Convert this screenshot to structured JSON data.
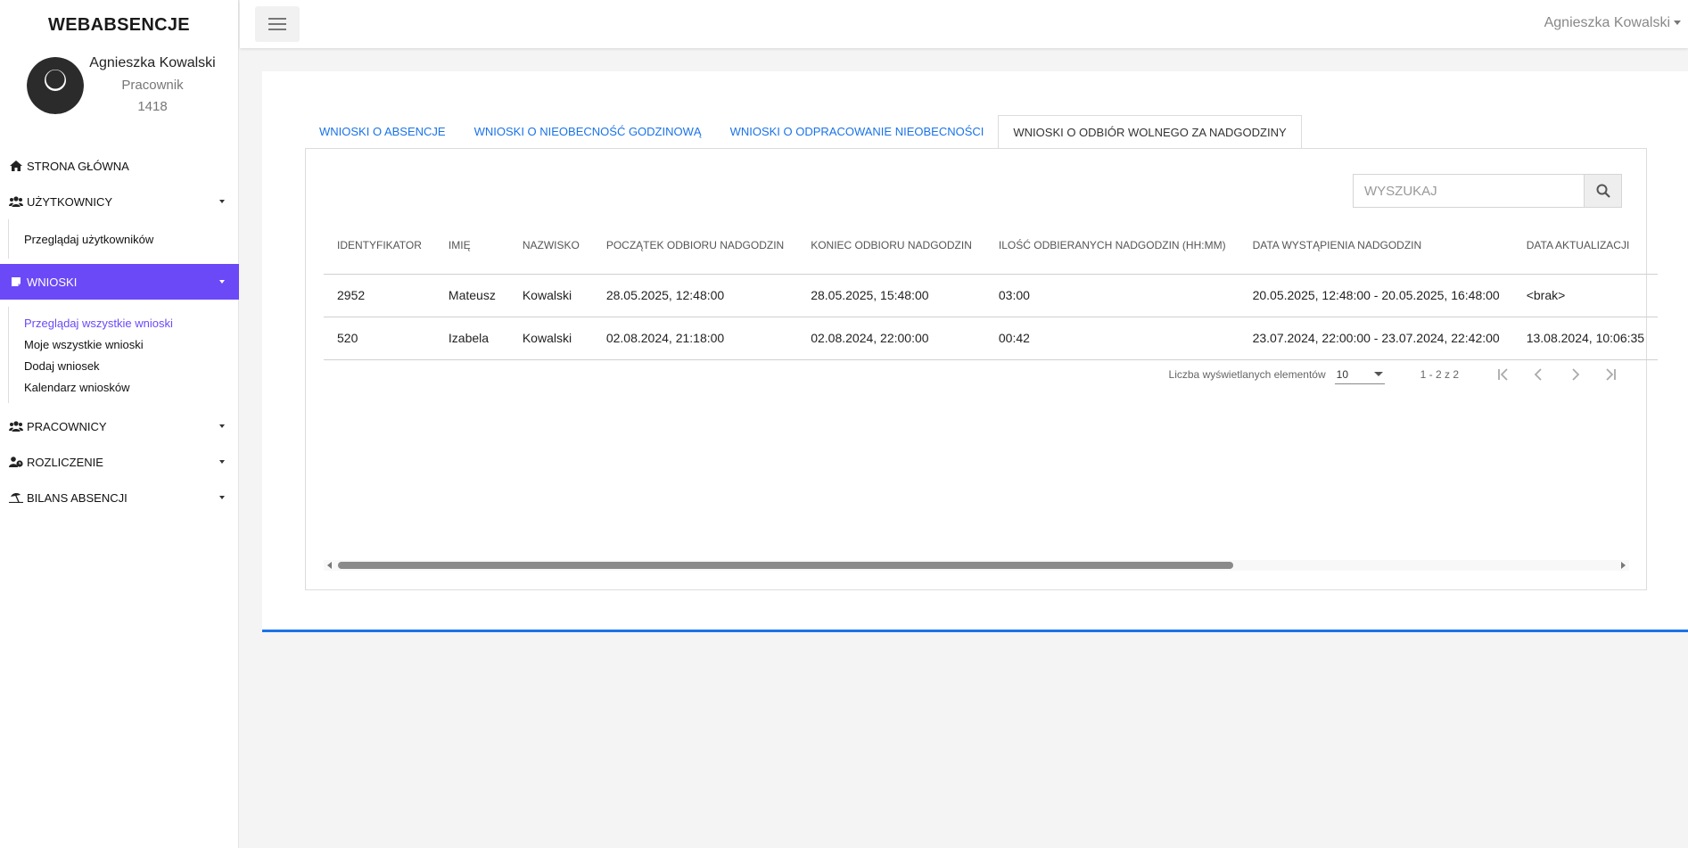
{
  "app": {
    "brand": "WEBABSENCJE"
  },
  "profile": {
    "name": "Agnieszka Kowalski",
    "role": "Pracownik",
    "id": "1418"
  },
  "sidebar": {
    "items": [
      {
        "label": "STRONA GŁÓWNA",
        "icon": "home-icon"
      },
      {
        "label": "UŻYTKOWNICY",
        "icon": "users-icon",
        "sub": [
          "Przeglądaj użytkowników"
        ]
      },
      {
        "label": "WNIOSKI",
        "icon": "note-icon",
        "active": true,
        "sub": [
          "Przeglądaj wszystkie wnioski",
          "Moje wszystkie wnioski",
          "Dodaj wniosek",
          "Kalendarz wniosków"
        ]
      },
      {
        "label": "PRACOWNICY",
        "icon": "users-icon"
      },
      {
        "label": "ROZLICZENIE",
        "icon": "user-clock-icon"
      },
      {
        "label": "BILANS ABSENCJI",
        "icon": "umbrella-beach-icon"
      }
    ]
  },
  "topbar": {
    "user": "Agnieszka Kowalski"
  },
  "tabs": [
    "WNIOSKI O ABSENCJE",
    "WNIOSKI O NIEOBECNOŚĆ GODZINOWĄ",
    "WNIOSKI O ODPRACOWANIE NIEOBECNOŚCI",
    "WNIOSKI O ODBIÓR WOLNEGO ZA NADGODZINY"
  ],
  "active_tab": 3,
  "search": {
    "placeholder": "WYSZUKAJ"
  },
  "table": {
    "columns": [
      "IDENTYFIKATOR",
      "IMIĘ",
      "NAZWISKO",
      "POCZĄTEK ODBIORU NADGODZIN",
      "KONIEC ODBIORU NADGODZIN",
      "ILOŚĆ ODBIERANYCH NADGODZIN (HH:MM)",
      "DATA WYSTĄPIENIA NADGODZIN",
      "DATA AKTUALIZACJI"
    ],
    "rows": [
      [
        "2952",
        "Mateusz",
        "Kowalski",
        "28.05.2025, 12:48:00",
        "28.05.2025, 15:48:00",
        "03:00",
        "20.05.2025, 12:48:00 - 20.05.2025, 16:48:00",
        "<brak>"
      ],
      [
        "520",
        "Izabela",
        "Kowalski",
        "02.08.2024, 21:18:00",
        "02.08.2024, 22:00:00",
        "00:42",
        "23.07.2024, 22:00:00 - 23.07.2024, 22:42:00",
        "13.08.2024, 10:06:35"
      ]
    ]
  },
  "pagination": {
    "label": "Liczba wyświetlanych elementów",
    "page_size": "10",
    "range": "1 - 2 z 2"
  },
  "colors": {
    "accent": "#6c49f7",
    "link": "#1a73e8"
  }
}
